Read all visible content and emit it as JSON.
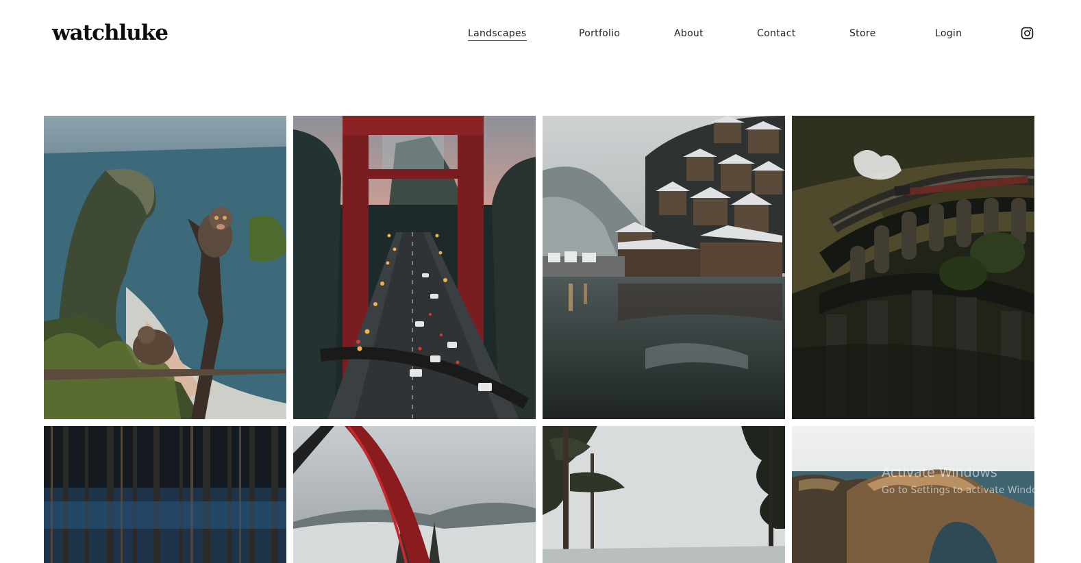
{
  "site": {
    "logo": "watchluke"
  },
  "nav": {
    "items": [
      {
        "label": "Landscapes",
        "active": true
      },
      {
        "label": "Portfolio",
        "active": false
      },
      {
        "label": "About",
        "active": false
      },
      {
        "label": "Contact",
        "active": false
      },
      {
        "label": "Store",
        "active": false
      },
      {
        "label": "Login",
        "active": false
      }
    ],
    "social_icon": "instagram-icon"
  },
  "gallery": {
    "photos": [
      {
        "subject": "monkey on cliff overlooking beach"
      },
      {
        "subject": "red suspension bridge with traffic"
      },
      {
        "subject": "lakeside alpine village"
      },
      {
        "subject": "steam train on curved viaduct"
      },
      {
        "subject": "dark forest with blue lights"
      },
      {
        "subject": "red railing over snowy hills"
      },
      {
        "subject": "pine trees against pale sky"
      },
      {
        "subject": "rock arch over sea"
      }
    ]
  },
  "overlay": {
    "title": "Activate Windows",
    "subtitle": "Go to Settings to activate Windows."
  }
}
